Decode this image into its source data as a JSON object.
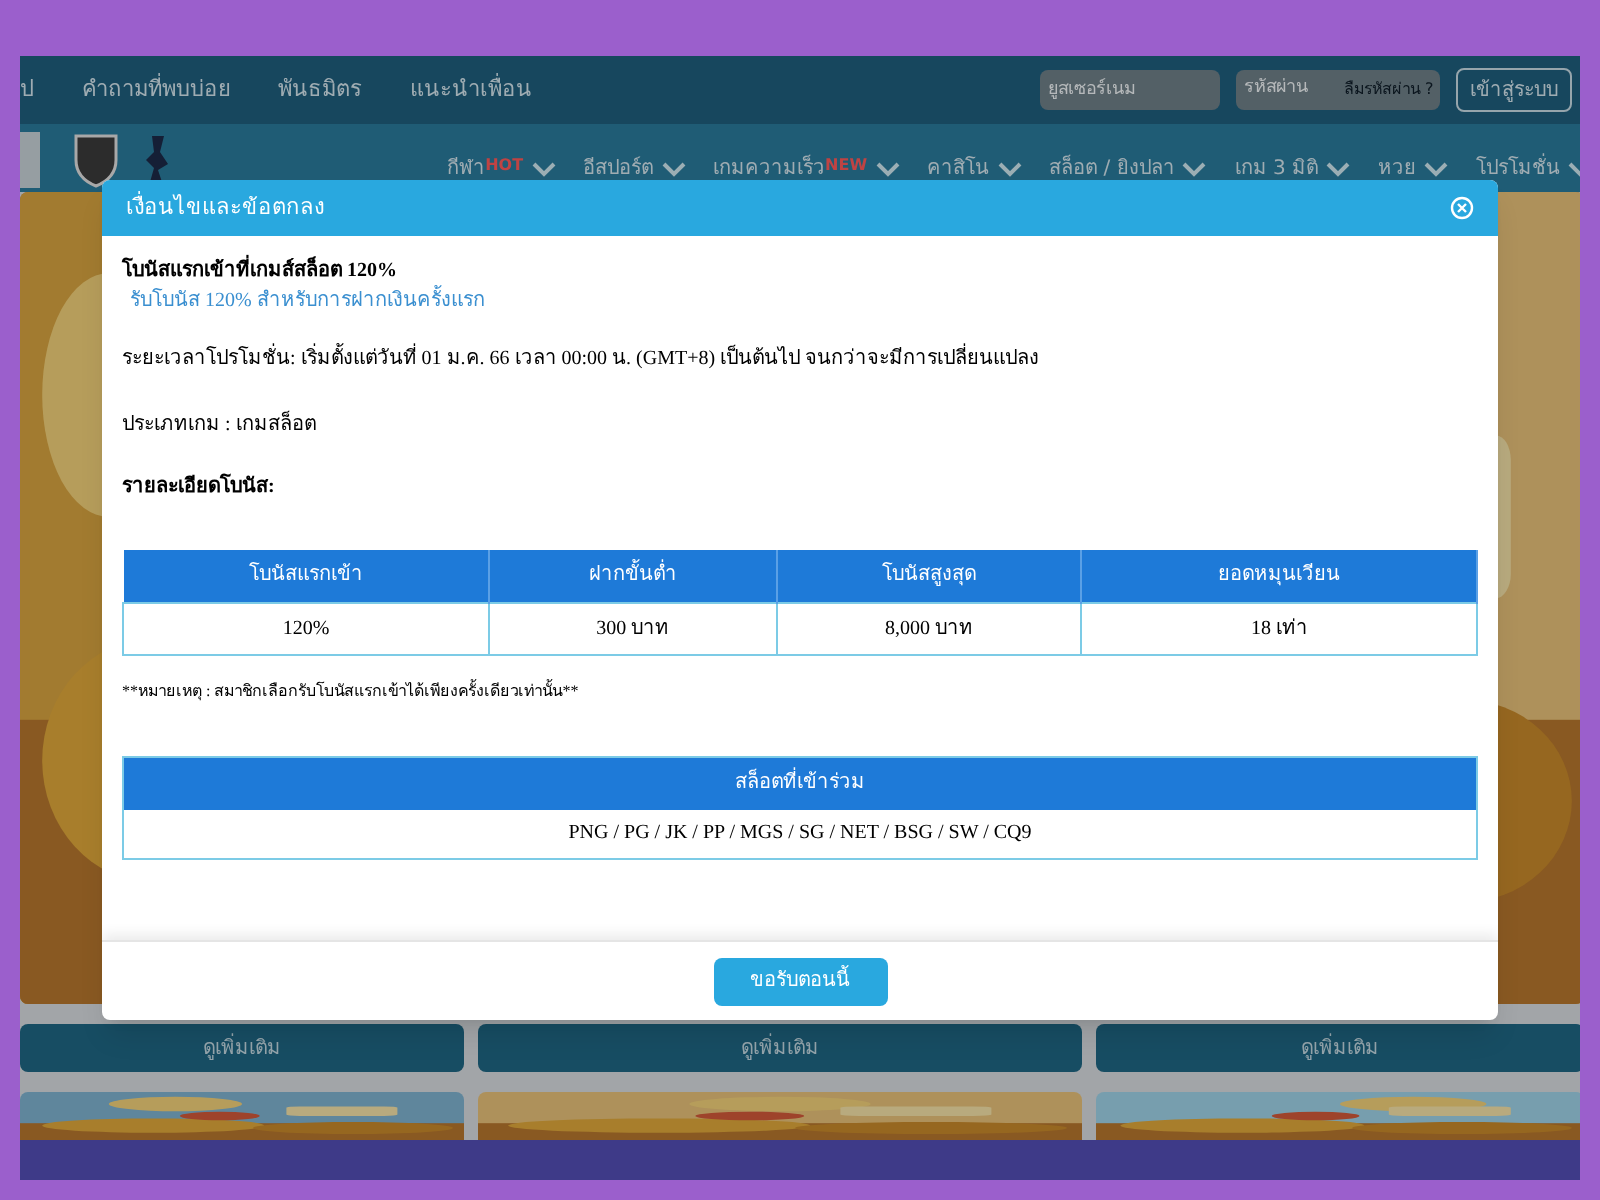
{
  "site_header": {
    "nav_links": [
      "ป",
      "คำถามที่พบบ่อย",
      "พันธมิตร",
      "แนะนำเพื่อน"
    ],
    "username_field": {
      "placeholder": "ยูสเซอร์เนม"
    },
    "password_field": {
      "placeholder": "รหัสผ่าน"
    },
    "forgot_password_link": "ลืมรหัสผ่าน ?",
    "login_button": "เข้าสู่ระบบ"
  },
  "menu": [
    {
      "label": "กีฬา",
      "badge": "HOT"
    },
    {
      "label": "อีสปอร์ต"
    },
    {
      "label": "เกมความเร็ว",
      "badge": "NEW"
    },
    {
      "label": "คาสิโน"
    },
    {
      "label": "สล็อต / ยิงปลา"
    },
    {
      "label": "เกม 3 มิติ"
    },
    {
      "label": "หวย"
    },
    {
      "label": "โปรโมชั่น"
    }
  ],
  "cards": [
    {
      "button": "ดูเพิ่มเติม"
    },
    {
      "button": "ดูเพิ่มเติม"
    },
    {
      "button": "ดูเพิ่มเติม"
    }
  ],
  "modal": {
    "title": "เงื่อนไขและข้อตกลง",
    "promo_title": "โบนัสแรกเข้าที่เกมส์สล็อต 120%",
    "promo_subtitle": "รับโบนัส 120% สำหรับการฝากเงินครั้งแรก",
    "period": "ระยะเวลาโปรโมชั่น: เริ่มตั้งแต่วันที่ 01 ม.ค. 66 เวลา 00:00 น. (GMT+8) เป็นต้นไป จนกว่าจะมีการเปลี่ยนแปลง",
    "game_type": "ประเภทเกม : เกมสล็อต",
    "details_heading": "รายละเอียดโบนัส:",
    "bonus_table": {
      "columns": [
        "โบนัสแรกเข้า",
        "ฝากขั้นต่ำ",
        "โบนัสสูงสุด",
        "ยอดหมุนเวียน"
      ],
      "rows": [
        [
          "120%",
          "300 บาท",
          "8,000 บาท",
          "18 เท่า"
        ]
      ]
    },
    "note": "**หมายเหตุ : สมาชิกเลือกรับโบนัสแรกเข้าได้เพียงครั้งเดียวเท่านั้น**",
    "slots_table": {
      "heading": "สล็อตที่เข้าร่วม",
      "providers": "PNG / PG / JK / PP / MGS / SG / NET / BSG / SW / CQ9"
    },
    "claim_button": "ขอรับตอนนี้"
  }
}
